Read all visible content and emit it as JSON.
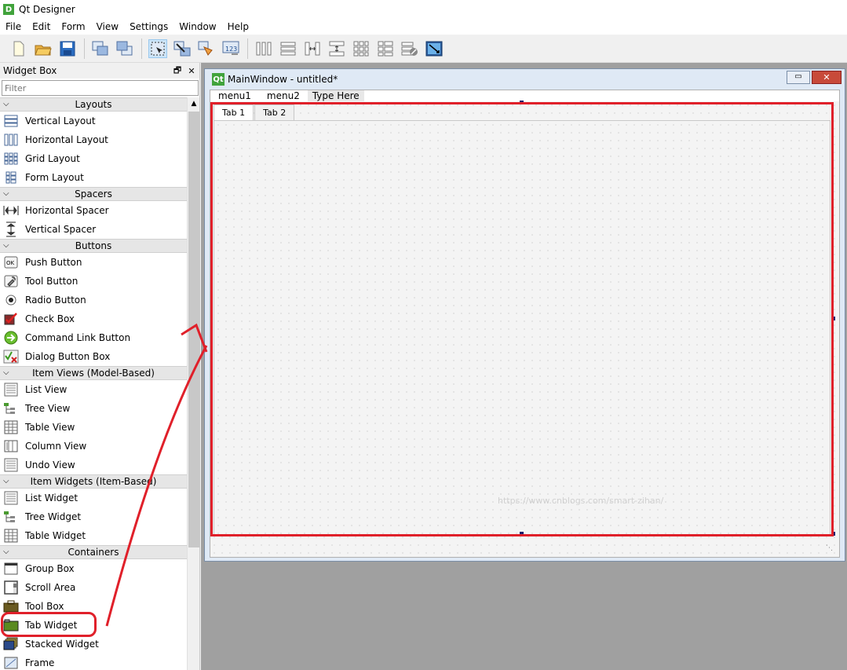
{
  "app": {
    "title": "Qt Designer",
    "logo": "D"
  },
  "menubar": {
    "items": [
      "File",
      "Edit",
      "Form",
      "View",
      "Settings",
      "Window",
      "Help"
    ]
  },
  "toolbar": {
    "buttons": [
      {
        "name": "new-form-icon"
      },
      {
        "name": "open-form-icon"
      },
      {
        "name": "save-form-icon"
      },
      {
        "name": "send-to-back-icon"
      },
      {
        "name": "bring-to-front-icon"
      },
      {
        "name": "edit-widgets-icon",
        "active": true
      },
      {
        "name": "edit-signals-slots-icon"
      },
      {
        "name": "edit-buddies-icon"
      },
      {
        "name": "edit-tab-order-icon"
      },
      {
        "name": "layout-horizontal-icon"
      },
      {
        "name": "layout-vertical-icon"
      },
      {
        "name": "layout-h-splitter-icon"
      },
      {
        "name": "layout-v-splitter-icon"
      },
      {
        "name": "layout-grid-icon"
      },
      {
        "name": "layout-form-icon"
      },
      {
        "name": "break-layout-icon"
      },
      {
        "name": "adjust-size-icon"
      }
    ]
  },
  "widget_box": {
    "title": "Widget Box",
    "float_icon": "🗗",
    "close_icon": "✕",
    "filter_placeholder": "Filter",
    "categories": [
      {
        "label": "Layouts",
        "items": [
          "Vertical Layout",
          "Horizontal Layout",
          "Grid Layout",
          "Form Layout"
        ]
      },
      {
        "label": "Spacers",
        "items": [
          "Horizontal Spacer",
          "Vertical Spacer"
        ]
      },
      {
        "label": "Buttons",
        "items": [
          "Push Button",
          "Tool Button",
          "Radio Button",
          "Check Box",
          "Command Link Button",
          "Dialog Button Box"
        ]
      },
      {
        "label": "Item Views (Model-Based)",
        "items": [
          "List View",
          "Tree View",
          "Table View",
          "Column View",
          "Undo View"
        ]
      },
      {
        "label": "Item Widgets (Item-Based)",
        "items": [
          "List Widget",
          "Tree Widget",
          "Table Widget"
        ]
      },
      {
        "label": "Containers",
        "items": [
          "Group Box",
          "Scroll Area",
          "Tool Box",
          "Tab Widget",
          "Stacked Widget",
          "Frame"
        ]
      }
    ]
  },
  "form_window": {
    "title": "MainWindow - untitled*",
    "logo": "Qt",
    "minimize_glyph": "▭",
    "close_glyph": "✕",
    "menus": [
      "menu1",
      "menu2"
    ],
    "type_here": "Type Here",
    "tabs": [
      "Tab 1",
      "Tab 2"
    ],
    "selected_tab": 0
  },
  "watermark": "https://www.cnblogs.com/smart-zihan/",
  "colors": {
    "annotation_red": "#e0202a",
    "qt_green": "#41a33c"
  }
}
